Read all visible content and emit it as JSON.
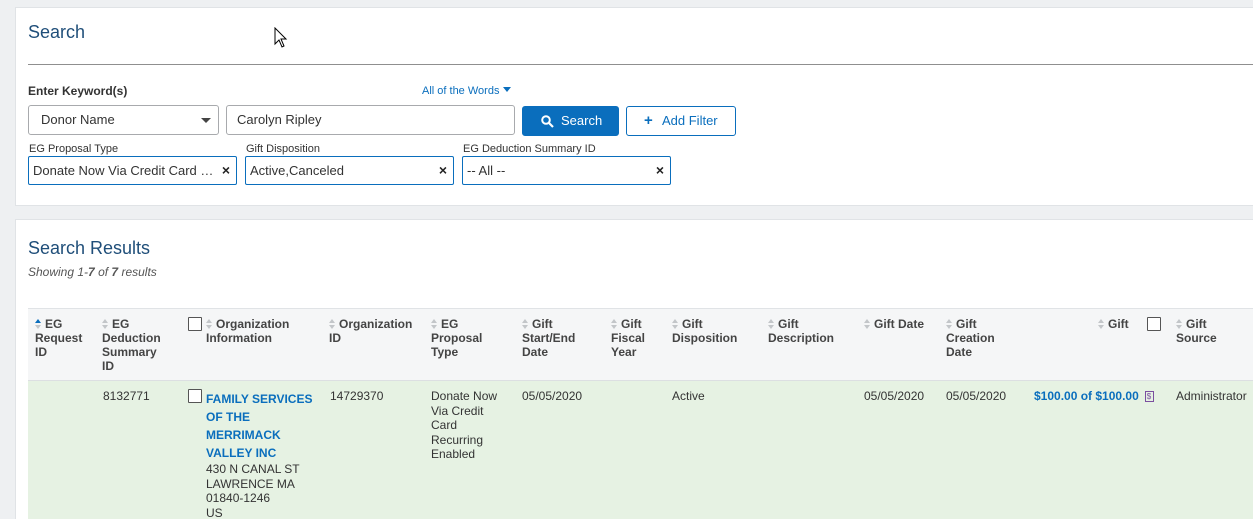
{
  "search": {
    "title": "Search",
    "keyword_label": "Enter Keyword(s)",
    "match_mode": "All of the Words",
    "field_select": "Donor Name",
    "keyword_value": "Carolyn Ripley",
    "search_button": "Search",
    "add_filter_button": "Add Filter",
    "filters": [
      {
        "label": "EG Proposal Type",
        "value": "Donate Now Via Credit Card Recurring Enabled"
      },
      {
        "label": "Gift Disposition",
        "value": "Active,Canceled"
      },
      {
        "label": "EG Deduction Summary ID",
        "value": "-- All --"
      }
    ]
  },
  "results": {
    "title": "Search Results",
    "showing_prefix": "Showing 1-",
    "showing_to": "7",
    "showing_of": " of ",
    "showing_total": "7",
    "showing_suffix": " results",
    "columns": [
      "EG Request ID",
      "EG Deduction Summary ID",
      "Organization Information",
      "Organization ID",
      "EG Proposal Type",
      "Gift Start/End Date",
      "Gift Fiscal Year",
      "Gift Disposition",
      "Gift Description",
      "Gift Date",
      "Gift Creation Date",
      "Gift",
      "Gift Source"
    ],
    "rows": [
      {
        "eg_request_id": "",
        "deduction_summary_id": "8132771",
        "org_name": "FAMILY SERVICES OF THE MERRIMACK VALLEY INC",
        "org_address": [
          "430 N CANAL ST",
          "LAWRENCE MA",
          "01840-1246",
          "US"
        ],
        "org_id": "14729370",
        "proposal_type": "Donate Now Via Credit Card Recurring Enabled",
        "start_end_date": "05/05/2020",
        "fiscal_year": "",
        "disposition": "Active",
        "description": "",
        "gift_date": "05/05/2020",
        "creation_date": "05/05/2020",
        "gift_amount": "$100.00 of $100.00",
        "gift_source": "Administrator"
      }
    ]
  },
  "colors": {
    "accent": "#0a6ebd",
    "title": "#1f4e79",
    "row_highlight": "#e6f2e3"
  }
}
